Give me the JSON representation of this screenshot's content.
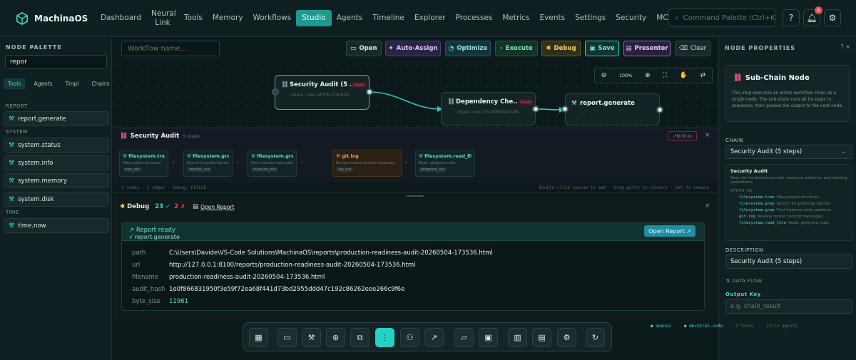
{
  "app": {
    "name": "MachinaOS"
  },
  "nav": [
    "Dashboard",
    "Neural Link",
    "Tools",
    "Memory",
    "Workflows",
    "Studio",
    "Agents",
    "Timeline",
    "Explorer",
    "Processes",
    "Metrics",
    "Events",
    "Settings",
    "Security",
    "MCP"
  ],
  "nav_active": "Studio",
  "command_palette": {
    "placeholder": "Command Palette (Ctrl+K)"
  },
  "notifications": {
    "count": "6"
  },
  "palette": {
    "title": "NODE PALETTE",
    "search_value": "repor",
    "tabs": [
      "Tools",
      "Agents",
      "Tmpl",
      "Chains"
    ],
    "groups": [
      {
        "name": "REPORT",
        "items": [
          "report.generate"
        ]
      },
      {
        "name": "SYSTEM",
        "items": [
          "system.status",
          "system.info",
          "system.memory",
          "system.disk"
        ]
      },
      {
        "name": "TIME",
        "items": [
          "time.now"
        ]
      }
    ]
  },
  "toolbar": {
    "workflow_placeholder": "Workflow name...",
    "buttons": [
      "Open",
      "Auto-Assign",
      "Optimize",
      "Execute",
      "Debug",
      "Save",
      "Presenter",
      "Clear"
    ]
  },
  "canvas": {
    "zoom": "100%",
    "nodes": [
      {
        "title": "Security Audit (5 ...",
        "sub": "chain: swc-af7f4c77b620",
        "tag": "chain"
      },
      {
        "title": "Dependency Che...",
        "sub": "chain: swc-5f1b9fbbee3db",
        "tag": "chain"
      },
      {
        "title": "report.generate",
        "sub": "...",
        "tag": ""
      }
    ]
  },
  "chain_panel": {
    "title": "Security Audit",
    "steps_count": "5 steps",
    "drill_in": "Drill in",
    "steps": [
      {
        "name": "filesystem.tree",
        "desc": "Map project structure",
        "out": "tree_out"
      },
      {
        "name": "filesystem.grep",
        "desc": "Search for potential secrets",
        "out": "secrets_out"
      },
      {
        "name": "filesystem.grep",
        "desc": "Find insecure code patterns",
        "out": "insecure_out"
      },
      {
        "name": "git.log",
        "desc": "Review recent commit messages",
        "out": "log_out"
      },
      {
        "name": "filesystem.read_file",
        "desc": "Read .gitignore rules",
        "out": "gitignore_out"
      }
    ]
  },
  "status_strip": {
    "left": "3 nodes · 2 edges · Debug: FAILED",
    "right": "Double-click canvas to add · Drag ports to connect · Del to remove"
  },
  "debug": {
    "label": "Debug",
    "ok": "23 ✓",
    "err": "2 ✗",
    "open_report": "Open Report",
    "banner_title": "Report ready",
    "banner_sub": "√ report.generate",
    "open_btn": "Open Report ↗",
    "fields": [
      {
        "k": "path",
        "v": "C:\\Users\\Davide\\VS-Code Solutions\\MachinaOS\\reports\\production-readiness-audit-20260504-173536.html"
      },
      {
        "k": "url",
        "v": "http://127.0.0.1:8100/reports/production-readiness-audit-20260504-173536.html"
      },
      {
        "k": "filename",
        "v": "production-readiness-audit-20260504-173536.html"
      },
      {
        "k": "audit_hash",
        "v": "1e0f866831950f3e59f72ea68f441d73bd2955ddd47c192c86262eee266c9f6e"
      },
      {
        "k": "byte_size",
        "v": "11961"
      }
    ]
  },
  "props": {
    "title": "NODE PROPERTIES",
    "card_title": "Sub-Chain Node",
    "card_desc": "This step executes an entire workflow chain as a single node. The sub-chain runs all its steps in sequence, then passes the output to the next node.",
    "chain_label": "CHAIN",
    "chain_value": "Security Audit (5 steps)",
    "detail_name": "Security Audit",
    "detail_desc": "Scan for hardcoded secrets, insecure patterns, and missing protections.",
    "detail_steps_label": "STEPS (5)",
    "detail_steps": [
      {
        "n": "filesystem.tree",
        "t": "Map project structure"
      },
      {
        "n": "filesystem.grep",
        "t": "Search for potential secrets"
      },
      {
        "n": "filesystem.grep",
        "t": "Find insecure code patterns"
      },
      {
        "n": "git.log",
        "t": "Review recent commit messages"
      },
      {
        "n": "filesystem.read_file",
        "t": "Read .gitignore rules"
      }
    ],
    "description_label": "DESCRIPTION",
    "description_value": "Security Audit (5 steps)",
    "data_flow_label": "DATA FLOW",
    "output_key_label": "Output Key",
    "output_key_placeholder": "e.g. chain_result"
  },
  "bottom_status": [
    "● openai",
    "● devstral-code",
    "0 tasks",
    "12/12 agents"
  ],
  "colors": {
    "accent": "#22d3c4",
    "chain": "#e25b7a",
    "error": "#e24b4b",
    "bg": "#0d1a1c"
  }
}
